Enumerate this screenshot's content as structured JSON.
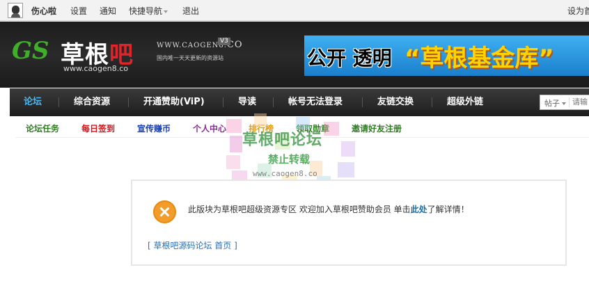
{
  "topbar": {
    "username": "伤心啦",
    "settings": "设置",
    "notifications": "通知",
    "quick_nav": "快捷导航",
    "logout": "退出",
    "set_home": "设为首"
  },
  "header": {
    "logo_mark": "GS",
    "logo_name_white": "草根",
    "logo_name_red": "吧",
    "logo_url": "www.caogen8.co",
    "logo_domain": "WWW.CAOGEN8.",
    "logo_domain_suffix": "CO",
    "logo_version": "V3",
    "logo_tagline": "国内唯一天天更新的资源站",
    "banner_left": "公开 透明",
    "banner_right": "“草根基金库”"
  },
  "nav": {
    "tabs": [
      {
        "label": "论坛"
      },
      {
        "label": "综合资源"
      },
      {
        "label": "开通赞助(ViP)"
      },
      {
        "label": "导读"
      },
      {
        "label": "帐号无法登录"
      },
      {
        "label": "友链交换"
      },
      {
        "label": "超级外链"
      }
    ],
    "search_type": "帖子",
    "search_placeholder": "请输"
  },
  "subnav": {
    "links": [
      {
        "label": "论坛任务",
        "color": "#2e7d1f"
      },
      {
        "label": "每日签到",
        "color": "#d2141b"
      },
      {
        "label": "宣传赚币",
        "color": "#1a3fb0"
      },
      {
        "label": "个人中心",
        "color": "#8a2c92"
      },
      {
        "label": "排行榜",
        "color": "#e59d17"
      },
      {
        "label": "领取勋章",
        "color": "#2e7d1f"
      },
      {
        "label": "邀请好友注册",
        "color": "#2e7d1f"
      }
    ]
  },
  "watermark": {
    "line1": "草根吧论坛",
    "line2": "禁止转载",
    "line3": "www.caogen8.co"
  },
  "message": {
    "text_before": "此版块为草根吧超级资源专区 欢迎加入草根吧赞助会员 单击",
    "link": "此处",
    "text_after": "了解详情！",
    "back_link": "[ 草根吧源码论坛 首页 ]"
  }
}
